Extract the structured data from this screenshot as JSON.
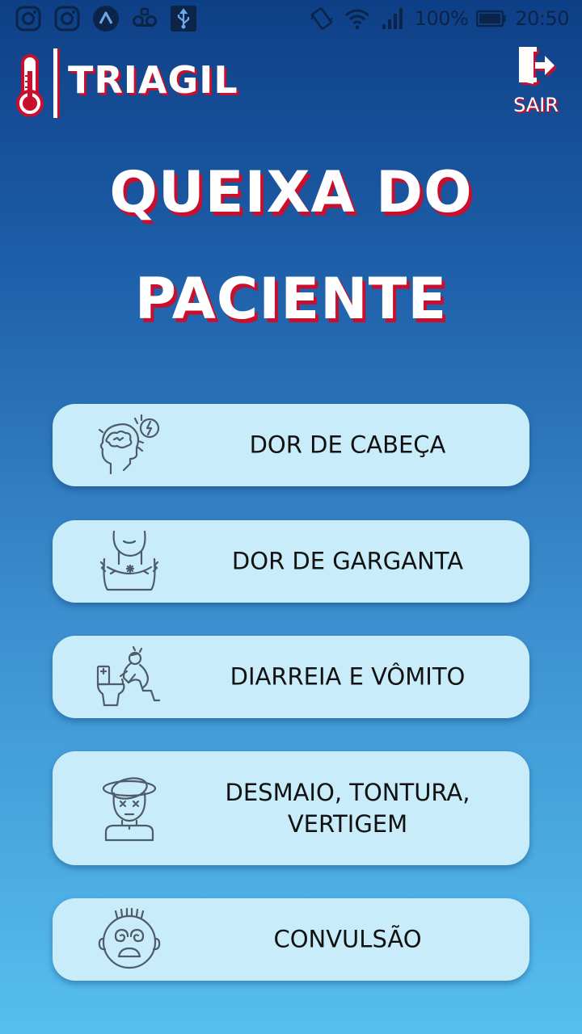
{
  "status_bar": {
    "left_icons": [
      "instagram-icon",
      "instagram-icon",
      "app-icon",
      "voicemail-icon",
      "usb-icon"
    ],
    "right_icons": [
      "vibrate-icon",
      "wifi-icon",
      "signal-icon",
      "battery-icon"
    ],
    "battery": "100%",
    "time": "20:50"
  },
  "header": {
    "brand": "TRIAGIL",
    "exit_label": "SAIR"
  },
  "page": {
    "title_line1": "QUEIXA DO",
    "title_line2": "PACIENTE"
  },
  "complaints": [
    {
      "label": "DOR DE CABEÇA",
      "icon": "headache-icon"
    },
    {
      "label": "DOR DE GARGANTA",
      "icon": "sore-throat-icon"
    },
    {
      "label": "DIARREIA E VÔMITO",
      "icon": "vomiting-icon"
    },
    {
      "label": "DESMAIO, TONTURA,\nVERTIGEM",
      "icon": "dizziness-icon"
    },
    {
      "label": "CONVULSÃO",
      "icon": "seizure-icon"
    }
  ],
  "colors": {
    "background_top": "#0e3f86",
    "background_bottom": "#56bfef",
    "button_fill": "#c9ecfa",
    "accent_red": "#c8102e",
    "text_dark": "#111111",
    "icon_stroke": "#4d5b6b"
  }
}
